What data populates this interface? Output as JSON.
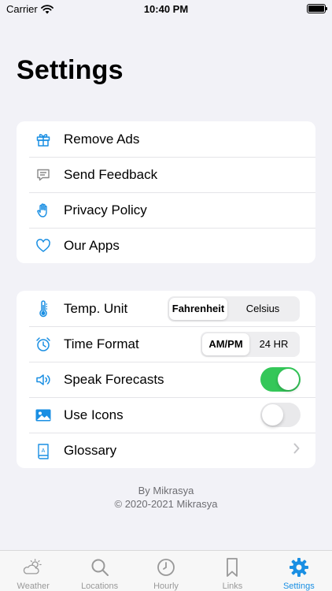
{
  "status_bar": {
    "carrier": "Carrier",
    "time": "10:40 PM"
  },
  "title": "Settings",
  "accent_color": "#1a8fe3",
  "group_general": [
    {
      "label": "Remove Ads",
      "icon": "gift-icon"
    },
    {
      "label": "Send Feedback",
      "icon": "message-icon"
    },
    {
      "label": "Privacy Policy",
      "icon": "hand-icon"
    },
    {
      "label": "Our Apps",
      "icon": "heart-icon"
    }
  ],
  "group_options": {
    "temp_unit": {
      "label": "Temp. Unit",
      "options": [
        "Fahrenheit",
        "Celsius"
      ],
      "selected": "Fahrenheit"
    },
    "time_format": {
      "label": "Time Format",
      "options": [
        "AM/PM",
        "24 HR"
      ],
      "selected": "AM/PM"
    },
    "speak_forecasts": {
      "label": "Speak Forecasts",
      "on": true
    },
    "use_icons": {
      "label": "Use Icons",
      "on": false
    },
    "glossary": {
      "label": "Glossary"
    }
  },
  "footer": {
    "line1": "By Mikrasya",
    "line2": "© 2020-2021 Mikrasya"
  },
  "tabs": [
    {
      "label": "Weather",
      "icon": "weather-icon"
    },
    {
      "label": "Locations",
      "icon": "search-icon"
    },
    {
      "label": "Hourly",
      "icon": "clock-icon"
    },
    {
      "label": "Links",
      "icon": "bookmark-icon"
    },
    {
      "label": "Settings",
      "icon": "gear-icon",
      "active": true
    }
  ]
}
